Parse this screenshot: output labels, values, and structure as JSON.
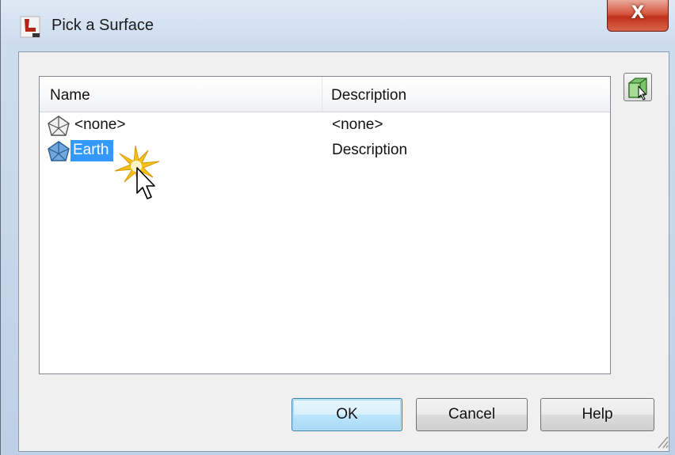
{
  "window": {
    "title": "Pick a Surface",
    "close_label": "X"
  },
  "list": {
    "columns": [
      "Name",
      "Description"
    ],
    "rows": [
      {
        "name": "<none>",
        "description": "<none>",
        "selected": false
      },
      {
        "name": "Earth",
        "description": "Description",
        "selected": true
      }
    ]
  },
  "buttons": {
    "ok": "OK",
    "cancel": "Cancel",
    "help": "Help"
  },
  "colors": {
    "selection": "#3399ff",
    "close_button": "#c0311b"
  },
  "icons": {
    "app": "civil3d-app-icon",
    "surface": "tin-surface-icon",
    "pick_from_drawing": "pick-from-drawing-icon",
    "cursor": "mouse-pointer-with-click-burst"
  }
}
